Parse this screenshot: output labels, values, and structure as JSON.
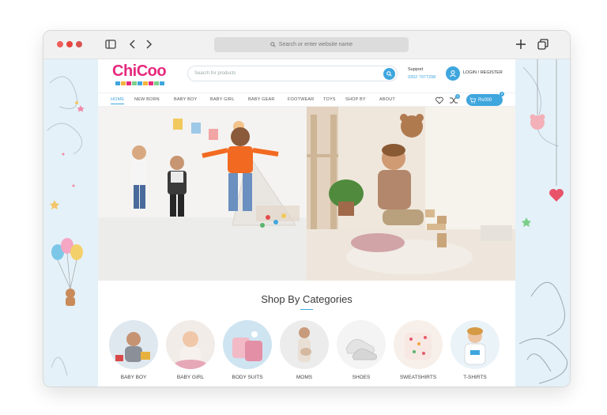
{
  "browser": {
    "url_placeholder": "Search or enter website name"
  },
  "site": {
    "logo_text": "ChiCoo",
    "search_placeholder": "Search for products",
    "support_label": "Support",
    "support_phone": "0302 7977298",
    "login_label": "LOGIN / REGISTER",
    "nav": [
      "HOME",
      "NEW BORN",
      "BABY BOY",
      "BABY GIRL",
      "BABY GEAR",
      "FOOTWEAR",
      "TOYS",
      "SHOP BY",
      "ABOUT"
    ],
    "cart_label": "Rs000",
    "compare_count": "0",
    "cart_count": "0"
  },
  "categories": {
    "title": "Shop By Categories",
    "items": [
      "BABY BOY",
      "BABY GIRL",
      "BODY SUITS",
      "MOMS",
      "SHOES",
      "SWEATSHIRTS",
      "T-SHIRTS"
    ]
  },
  "colors": {
    "accent": "#3fa6de",
    "brand": "#e6297e",
    "side_panel": "#e4f1f8"
  }
}
